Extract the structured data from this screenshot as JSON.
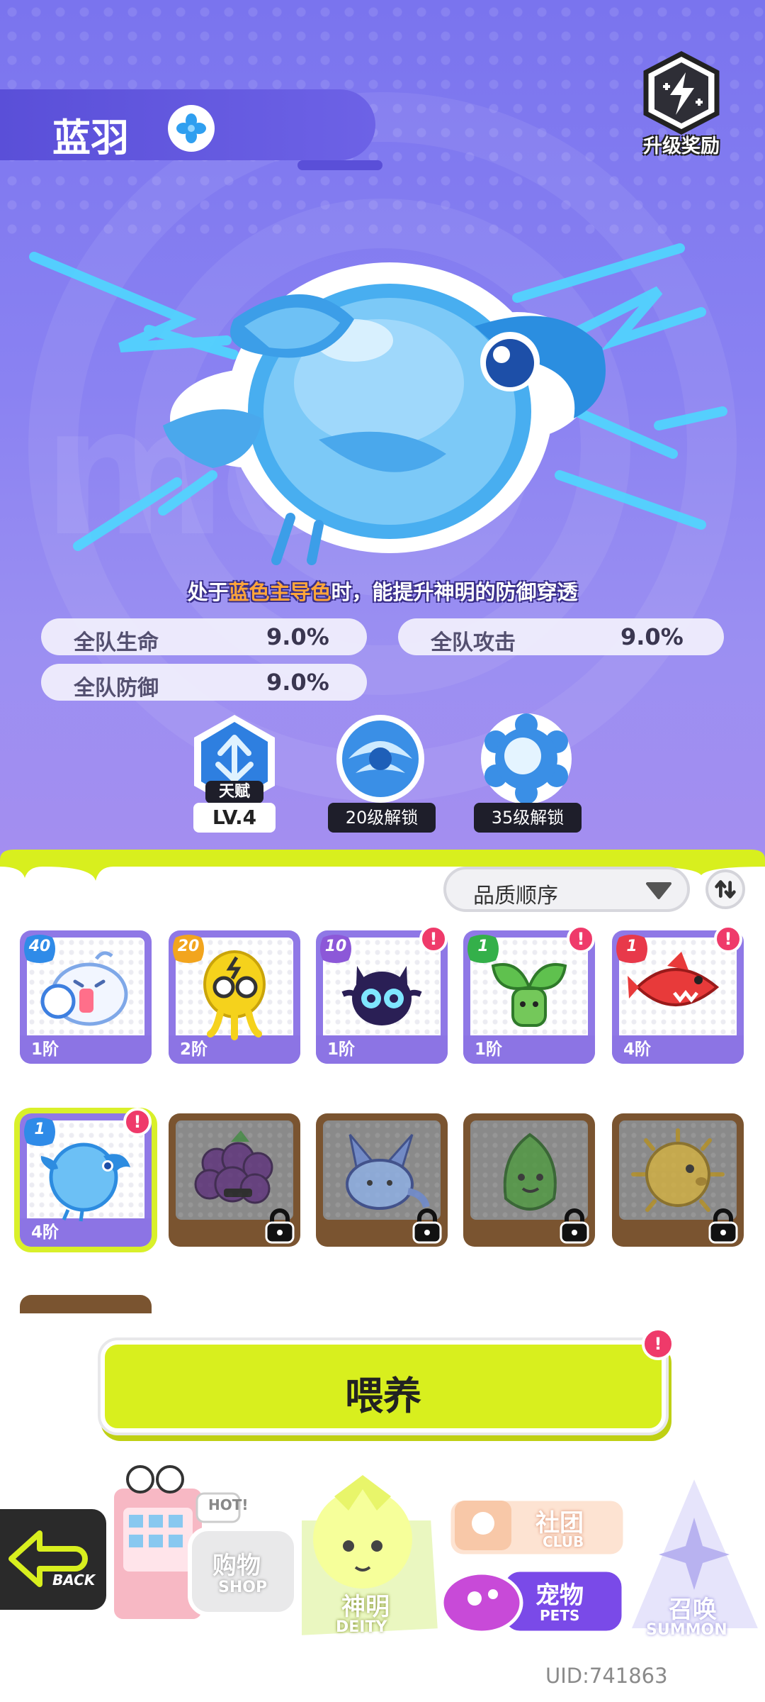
{
  "header": {
    "pet_name": "蓝羽",
    "element_icon": "water-element-icon",
    "levelup_reward_label": "升级奖励"
  },
  "passive": {
    "prefix": "处于",
    "highlight": "蓝色主导色",
    "suffix": "时，能提升神明的防御穿透",
    "highlight_color": "#ffa53a"
  },
  "stats": [
    {
      "label": "全队生命",
      "value": "9.0%"
    },
    {
      "label": "全队攻击",
      "value": "9.0%"
    },
    {
      "label": "全队防御",
      "value": "9.0%"
    }
  ],
  "skills": {
    "talent_tag": "天赋",
    "talent_level": "LV.4",
    "skill2_unlock": "20级解锁",
    "skill3_unlock": "35级解锁"
  },
  "sort": {
    "label": "品质顺序",
    "order_icon": "sort-order-icon"
  },
  "cards": [
    {
      "count": "40",
      "stage": "1阶",
      "art": "white-ghost-pet",
      "alert": false,
      "locked": false
    },
    {
      "count": "20",
      "stage": "2阶",
      "art": "yellow-bulb-pet",
      "alert": false,
      "locked": false
    },
    {
      "count": "10",
      "stage": "1阶",
      "art": "dark-cat-pet",
      "alert": true,
      "locked": false
    },
    {
      "count": "1",
      "stage": "1阶",
      "art": "leaf-sprout-pet",
      "alert": true,
      "locked": false
    },
    {
      "count": "1",
      "stage": "4阶",
      "art": "red-shark-pet",
      "alert": true,
      "locked": false
    },
    {
      "count": "1",
      "stage": "4阶",
      "art": "blue-bird-pet",
      "alert": true,
      "locked": false,
      "selected": true
    },
    {
      "art": "grape-pet",
      "locked": true
    },
    {
      "art": "blue-bunny-pet",
      "locked": true
    },
    {
      "art": "green-leaf-pet",
      "locked": true
    },
    {
      "art": "gold-puffer-pet",
      "locked": true
    }
  ],
  "feed_button": {
    "label": "喂养",
    "alert": "!"
  },
  "nav": {
    "back": "BACK",
    "shop_cn": "购物",
    "shop_en": "SHOP",
    "shop_hot": "HOT!",
    "deity_cn": "神明",
    "deity_en": "DEITY",
    "club_cn": "社团",
    "club_en": "CLUB",
    "pets_cn": "宠物",
    "pets_en": "PETS",
    "summon_cn": "召唤",
    "summon_en": "SUMMON"
  },
  "uid": "UID:741863",
  "colors": {
    "accent_lime": "#d8ef1e",
    "hero_purple": "#8a82f2",
    "alert_pink": "#ef3a6a"
  }
}
